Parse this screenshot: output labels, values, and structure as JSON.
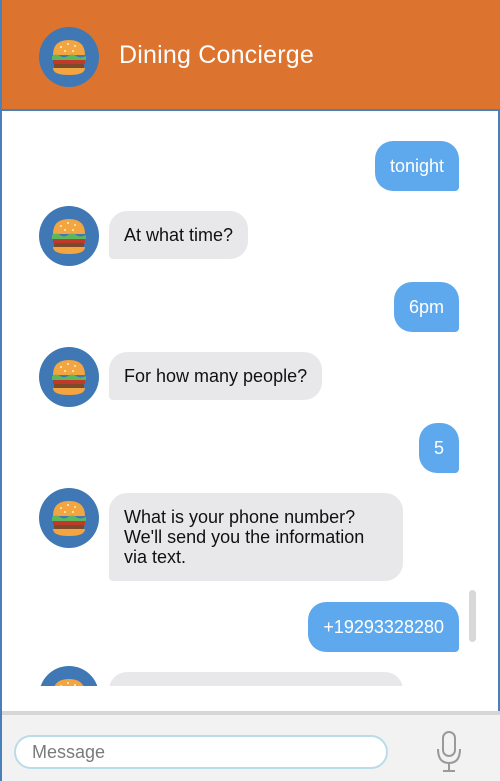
{
  "header": {
    "title": "Dining Concierge",
    "avatar_icon": "hamburger-icon"
  },
  "messages": [
    {
      "sender": "user",
      "text": "tonight"
    },
    {
      "sender": "bot",
      "lines": [
        "At what time?"
      ]
    },
    {
      "sender": "user",
      "text": "6pm"
    },
    {
      "sender": "bot",
      "lines": [
        "For how many people?"
      ]
    },
    {
      "sender": "user",
      "text": "5"
    },
    {
      "sender": "bot",
      "lines": [
        "What is your phone number?",
        "We'll send you the information",
        "via text."
      ]
    },
    {
      "sender": "user",
      "text": "+19293328280"
    }
  ],
  "composer": {
    "placeholder": "Message",
    "mic_icon": "microphone-icon"
  },
  "colors": {
    "header": "#dc7430",
    "user_bubble": "#5ea9ee",
    "bot_bubble": "#e8e8ea",
    "avatar_bg": "#3f78b4"
  }
}
